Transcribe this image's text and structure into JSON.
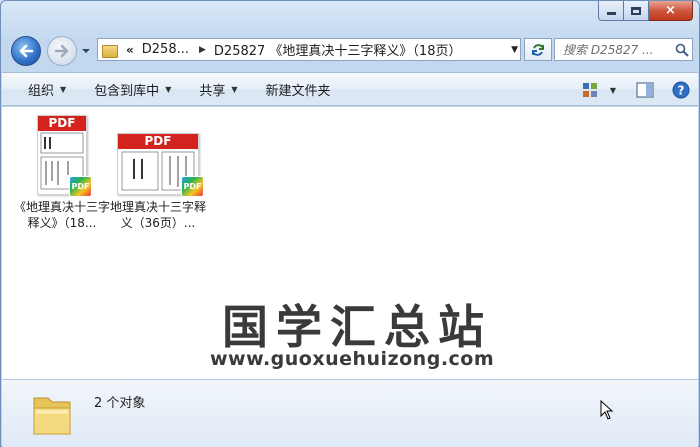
{
  "window": {
    "caption_close": "×"
  },
  "nav": {
    "address": {
      "chevrons": "«",
      "crumbs": [
        "D258...",
        "D25827 《地理真决十三字释义》（18页）"
      ]
    },
    "search_placeholder": "搜索 D25827 ..."
  },
  "toolbar": {
    "organize": "组织",
    "include_library": "包含到库中",
    "share": "共享",
    "new_folder": "新建文件夹"
  },
  "files": [
    {
      "name": "《地理真决十三字释义》（18...",
      "thumb_label": "PDF",
      "badge": "PDF"
    },
    {
      "name": "地理真决十三字释义（36页）...",
      "thumb_label": "PDF",
      "badge": "PDF"
    }
  ],
  "watermark": {
    "title": "国学汇总站",
    "url": "www.guoxuehuizong.com"
  },
  "status": {
    "count": "2 个对象"
  },
  "colors": {
    "accent": "#2c6ec7",
    "pdf_red": "#d2231f"
  }
}
